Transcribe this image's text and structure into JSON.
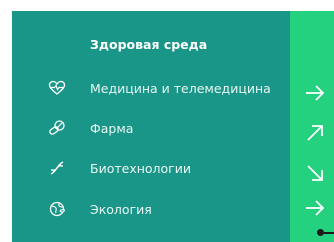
{
  "menu": {
    "heading": "Здоровая среда",
    "items": [
      {
        "label": "Медицина и телемедицина",
        "icon": "heart-pulse-icon"
      },
      {
        "label": "Фарма",
        "icon": "pills-icon"
      },
      {
        "label": "Биотехнологии",
        "icon": "dna-icon"
      },
      {
        "label": "Экология",
        "icon": "globe-leaf-icon"
      }
    ]
  },
  "side_arrows": [
    "arrow-right-icon",
    "arrow-up-right-icon",
    "arrow-down-right-icon",
    "arrow-right-icon"
  ],
  "colors": {
    "panel": "#1a9688",
    "side": "#23d17f",
    "text": "#ffffff"
  }
}
